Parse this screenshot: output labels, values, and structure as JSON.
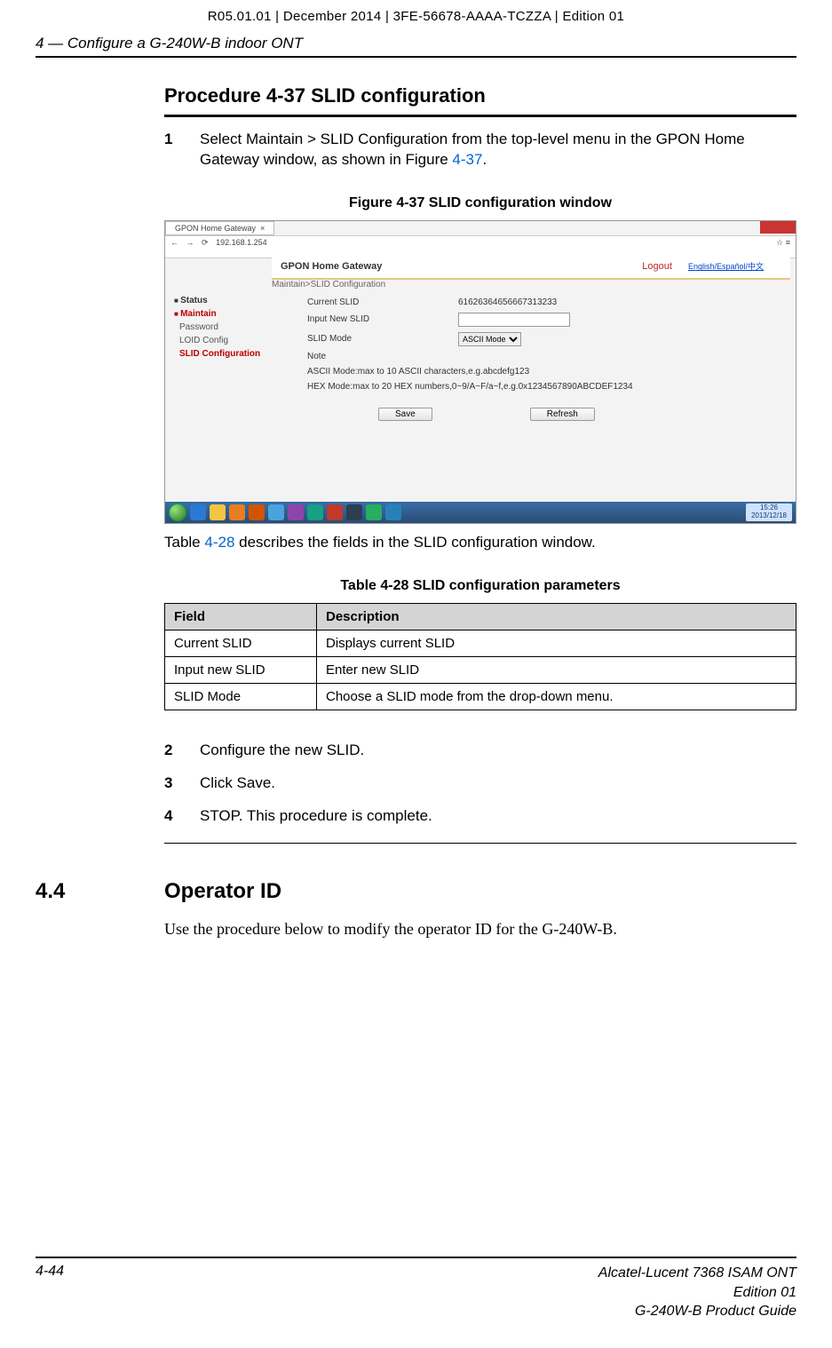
{
  "header": {
    "version_line": "R05.01.01 | December 2014 | 3FE-56678-AAAA-TCZZA | Edition 01",
    "chapter": "4 —  Configure a G-240W-B indoor ONT"
  },
  "procedure": {
    "title": "Procedure 4-37  SLID configuration",
    "steps": {
      "s1_num": "1",
      "s1_text_a": "Select Maintain > SLID Configuration from the top-level menu in the GPON Home Gateway window, as shown in Figure ",
      "s1_link": "4-37",
      "s1_text_b": ".",
      "s2_num": "2",
      "s2_text": "Configure the new SLID.",
      "s3_num": "3",
      "s3_text": "Click Save.",
      "s4_num": "4",
      "s4_text": "STOP. This procedure is complete."
    }
  },
  "figure": {
    "caption": "Figure 4-37  SLID configuration window",
    "post_text_a": "Table ",
    "post_link": "4-28",
    "post_text_b": " describes the fields in the SLID configuration window."
  },
  "screenshot": {
    "tab_title": "GPON Home Gateway",
    "address": "192.168.1.254",
    "header_title": "GPON Home Gateway",
    "logout": "Logout",
    "lang": "English/Español/中文",
    "breadcrumb": "Maintain>SLID Configuration",
    "sidebar": {
      "status": "Status",
      "maintain": "Maintain",
      "password": "Password",
      "loid": "LOID Config",
      "slid": "SLID Configuration"
    },
    "form": {
      "current_lbl": "Current SLID",
      "current_val": "61626364656667313233",
      "input_lbl": "Input New SLID",
      "mode_lbl": "SLID Mode",
      "mode_val": "ASCII Mode",
      "note_lbl": "Note",
      "note1": "ASCII Mode:max to 10 ASCII characters,e.g.abcdefg123",
      "note2": "HEX Mode:max to 20 HEX numbers,0~9/A~F/a~f,e.g.0x1234567890ABCDEF1234",
      "save": "Save",
      "refresh": "Refresh"
    },
    "clock": {
      "time": "15:26",
      "date": "2013/12/18"
    }
  },
  "table": {
    "caption": "Table 4-28 SLID configuration parameters",
    "head_field": "Field",
    "head_desc": "Description",
    "rows": [
      {
        "field": "Current SLID",
        "desc": "Displays current SLID"
      },
      {
        "field": "Input new SLID",
        "desc": "Enter new SLID"
      },
      {
        "field": "SLID Mode",
        "desc": "Choose a SLID mode from the drop-down menu."
      }
    ]
  },
  "section": {
    "num": "4.4",
    "title": "Operator ID",
    "body": "Use the procedure below to modify the operator ID for the G-240W-B."
  },
  "footer": {
    "page": "4-44",
    "line1": "Alcatel-Lucent 7368 ISAM ONT",
    "line2": "Edition 01",
    "line3": "G-240W-B Product Guide"
  }
}
